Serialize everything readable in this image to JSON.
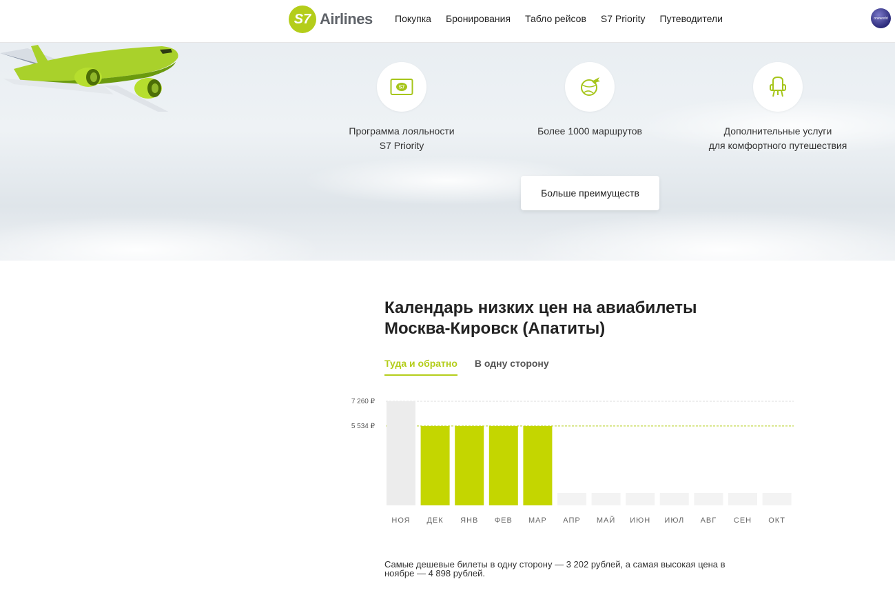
{
  "header": {
    "logo_mark": "S7",
    "logo_text": "Airlines",
    "nav": [
      "Покупка",
      "Бронирования",
      "Табло рейсов",
      "S7 Priority",
      "Путеводители"
    ],
    "badge_text": "oneworld"
  },
  "hero": {
    "features": [
      {
        "icon": "s7-card-icon",
        "text": "Программа лояльности\nS7 Priority"
      },
      {
        "icon": "globe-plane-icon",
        "text": "Более 1000 маршрутов"
      },
      {
        "icon": "seat-icon",
        "text": "Дополнительные услуги\nдля комфортного путешествия"
      }
    ],
    "more_button": "Больше преимуществ"
  },
  "main": {
    "title_line1": "Календарь низких цен на авиабилеты",
    "title_line2": "Москва-Кировск (Апатиты)",
    "tabs": [
      {
        "label": "Туда и обратно",
        "active": true
      },
      {
        "label": "В одну сторону",
        "active": false
      }
    ],
    "footnote": "Самые дешевые билеты в одну сторону — 3 202 рублей, а самая высокая цена в ноябре — 4 898 рублей."
  },
  "chart_data": {
    "type": "bar",
    "categories": [
      "НОЯ",
      "ДЕК",
      "ЯНВ",
      "ФЕВ",
      "МАР",
      "АПР",
      "МАЙ",
      "ИЮН",
      "ИЮЛ",
      "АВГ",
      "СЕН",
      "ОКТ"
    ],
    "values": [
      7260,
      5534,
      5534,
      5534,
      5534,
      null,
      null,
      null,
      null,
      null,
      null,
      null
    ],
    "reference_lines": [
      {
        "value": 7260,
        "label": "7 260 ₽",
        "color": "#dddddd"
      },
      {
        "value": 5534,
        "label": "5 534 ₽",
        "color": "#b4cd1a"
      }
    ],
    "highlight_color": "#c4d600",
    "max_color": "#ececec",
    "empty_color": "#f3f3f3",
    "ylim": [
      0,
      7260
    ]
  }
}
